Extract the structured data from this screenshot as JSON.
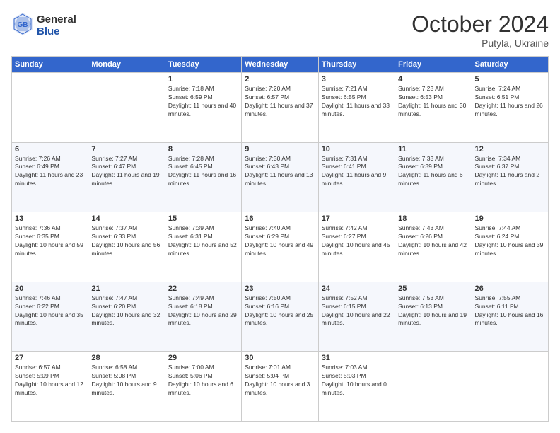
{
  "header": {
    "logo": {
      "line1": "General",
      "line2": "Blue"
    },
    "title": "October 2024",
    "subtitle": "Putyla, Ukraine"
  },
  "days_of_week": [
    "Sunday",
    "Monday",
    "Tuesday",
    "Wednesday",
    "Thursday",
    "Friday",
    "Saturday"
  ],
  "weeks": [
    [
      null,
      null,
      {
        "day": 1,
        "sunrise": "7:18 AM",
        "sunset": "6:59 PM",
        "daylight": "11 hours and 40 minutes."
      },
      {
        "day": 2,
        "sunrise": "7:20 AM",
        "sunset": "6:57 PM",
        "daylight": "11 hours and 37 minutes."
      },
      {
        "day": 3,
        "sunrise": "7:21 AM",
        "sunset": "6:55 PM",
        "daylight": "11 hours and 33 minutes."
      },
      {
        "day": 4,
        "sunrise": "7:23 AM",
        "sunset": "6:53 PM",
        "daylight": "11 hours and 30 minutes."
      },
      {
        "day": 5,
        "sunrise": "7:24 AM",
        "sunset": "6:51 PM",
        "daylight": "11 hours and 26 minutes."
      }
    ],
    [
      {
        "day": 6,
        "sunrise": "7:26 AM",
        "sunset": "6:49 PM",
        "daylight": "11 hours and 23 minutes."
      },
      {
        "day": 7,
        "sunrise": "7:27 AM",
        "sunset": "6:47 PM",
        "daylight": "11 hours and 19 minutes."
      },
      {
        "day": 8,
        "sunrise": "7:28 AM",
        "sunset": "6:45 PM",
        "daylight": "11 hours and 16 minutes."
      },
      {
        "day": 9,
        "sunrise": "7:30 AM",
        "sunset": "6:43 PM",
        "daylight": "11 hours and 13 minutes."
      },
      {
        "day": 10,
        "sunrise": "7:31 AM",
        "sunset": "6:41 PM",
        "daylight": "11 hours and 9 minutes."
      },
      {
        "day": 11,
        "sunrise": "7:33 AM",
        "sunset": "6:39 PM",
        "daylight": "11 hours and 6 minutes."
      },
      {
        "day": 12,
        "sunrise": "7:34 AM",
        "sunset": "6:37 PM",
        "daylight": "11 hours and 2 minutes."
      }
    ],
    [
      {
        "day": 13,
        "sunrise": "7:36 AM",
        "sunset": "6:35 PM",
        "daylight": "10 hours and 59 minutes."
      },
      {
        "day": 14,
        "sunrise": "7:37 AM",
        "sunset": "6:33 PM",
        "daylight": "10 hours and 56 minutes."
      },
      {
        "day": 15,
        "sunrise": "7:39 AM",
        "sunset": "6:31 PM",
        "daylight": "10 hours and 52 minutes."
      },
      {
        "day": 16,
        "sunrise": "7:40 AM",
        "sunset": "6:29 PM",
        "daylight": "10 hours and 49 minutes."
      },
      {
        "day": 17,
        "sunrise": "7:42 AM",
        "sunset": "6:27 PM",
        "daylight": "10 hours and 45 minutes."
      },
      {
        "day": 18,
        "sunrise": "7:43 AM",
        "sunset": "6:26 PM",
        "daylight": "10 hours and 42 minutes."
      },
      {
        "day": 19,
        "sunrise": "7:44 AM",
        "sunset": "6:24 PM",
        "daylight": "10 hours and 39 minutes."
      }
    ],
    [
      {
        "day": 20,
        "sunrise": "7:46 AM",
        "sunset": "6:22 PM",
        "daylight": "10 hours and 35 minutes."
      },
      {
        "day": 21,
        "sunrise": "7:47 AM",
        "sunset": "6:20 PM",
        "daylight": "10 hours and 32 minutes."
      },
      {
        "day": 22,
        "sunrise": "7:49 AM",
        "sunset": "6:18 PM",
        "daylight": "10 hours and 29 minutes."
      },
      {
        "day": 23,
        "sunrise": "7:50 AM",
        "sunset": "6:16 PM",
        "daylight": "10 hours and 25 minutes."
      },
      {
        "day": 24,
        "sunrise": "7:52 AM",
        "sunset": "6:15 PM",
        "daylight": "10 hours and 22 minutes."
      },
      {
        "day": 25,
        "sunrise": "7:53 AM",
        "sunset": "6:13 PM",
        "daylight": "10 hours and 19 minutes."
      },
      {
        "day": 26,
        "sunrise": "7:55 AM",
        "sunset": "6:11 PM",
        "daylight": "10 hours and 16 minutes."
      }
    ],
    [
      {
        "day": 27,
        "sunrise": "6:57 AM",
        "sunset": "5:09 PM",
        "daylight": "10 hours and 12 minutes."
      },
      {
        "day": 28,
        "sunrise": "6:58 AM",
        "sunset": "5:08 PM",
        "daylight": "10 hours and 9 minutes."
      },
      {
        "day": 29,
        "sunrise": "7:00 AM",
        "sunset": "5:06 PM",
        "daylight": "10 hours and 6 minutes."
      },
      {
        "day": 30,
        "sunrise": "7:01 AM",
        "sunset": "5:04 PM",
        "daylight": "10 hours and 3 minutes."
      },
      {
        "day": 31,
        "sunrise": "7:03 AM",
        "sunset": "5:03 PM",
        "daylight": "10 hours and 0 minutes."
      },
      null,
      null
    ]
  ]
}
